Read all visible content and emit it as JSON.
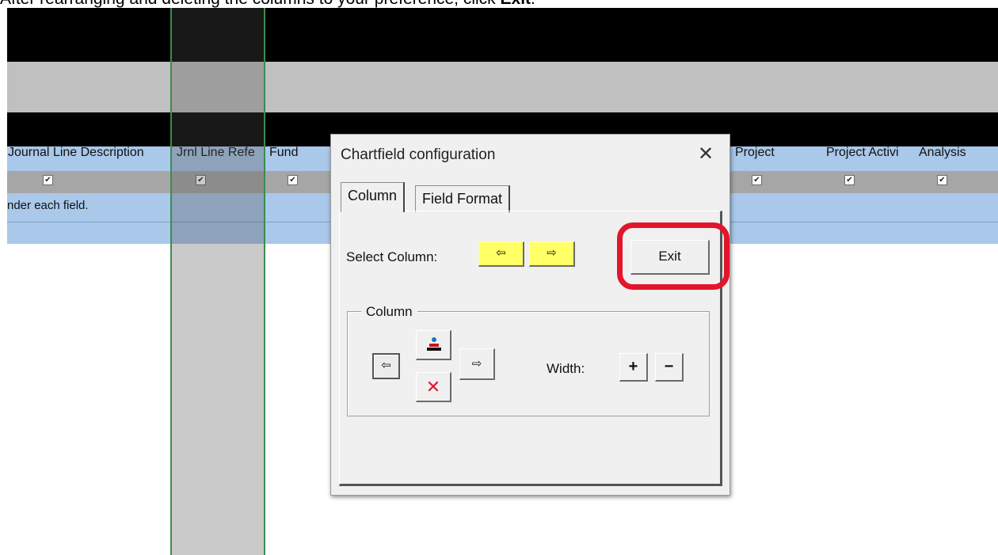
{
  "caption": {
    "prefix": "After rearranging and deleting the columns to your preference, click ",
    "emphasis": "Exit",
    "suffix": "."
  },
  "sheet": {
    "headers": [
      "Journal Line Description",
      "Jrnl Line Refe",
      "Fund",
      "Project",
      "Project Activi",
      "Analysis"
    ],
    "instruction_fragment": "nder each field."
  },
  "dialog": {
    "title": "Chartfield configuration",
    "tabs": [
      "Column",
      "Field Format"
    ],
    "select_column_label": "Select Column:",
    "exit_label": "Exit",
    "group_label": "Column",
    "width_label": "Width:",
    "width_plus": "+",
    "width_minus": "−",
    "delete_glyph": "✕",
    "icons": {
      "close": "close-icon",
      "select_prev": "arrow-left-icon",
      "select_next": "arrow-right-icon",
      "move_left": "arrow-left-icon",
      "move_right": "arrow-right-icon",
      "insert": "insert-column-icon",
      "delete": "delete-x-icon"
    }
  },
  "colors": {
    "highlight": "#e3152b",
    "nav_button": "#ffff66",
    "header_band": "#a9c8ea",
    "delete_x": "#e3152b"
  }
}
